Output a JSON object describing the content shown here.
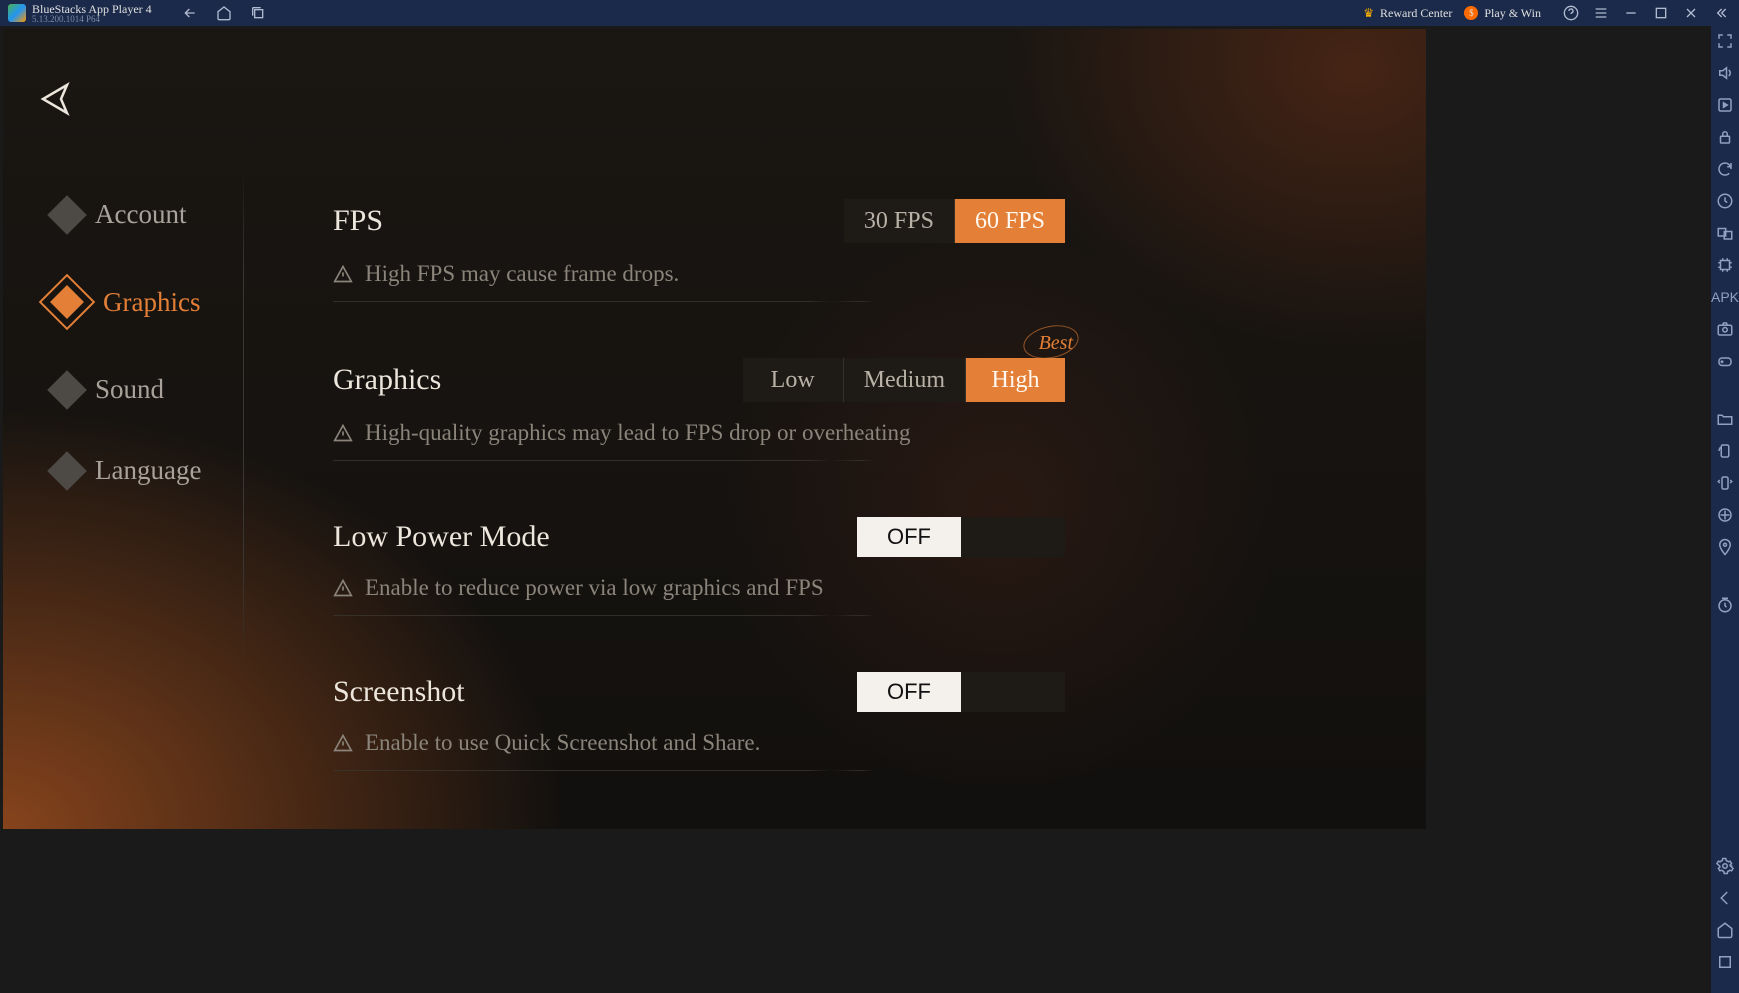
{
  "titlebar": {
    "app_name": "BlueStacks App Player 4",
    "version": "5.13.200.1014  P64",
    "reward_label": "Reward Center",
    "playwin_label": "Play & Win"
  },
  "sidebar": {
    "items": [
      {
        "label": "Account"
      },
      {
        "label": "Graphics"
      },
      {
        "label": "Sound"
      },
      {
        "label": "Language"
      }
    ],
    "active_index": 1
  },
  "settings": {
    "fps": {
      "title": "FPS",
      "hint": "High FPS may cause frame drops.",
      "options": [
        "30 FPS",
        "60 FPS"
      ],
      "active": 1
    },
    "graphics": {
      "title": "Graphics",
      "hint": "High-quality graphics may lead to FPS drop or overheating",
      "options": [
        "Low",
        "Medium",
        "High"
      ],
      "active": 2,
      "best_label": "Best"
    },
    "low_power": {
      "title": "Low Power Mode",
      "hint": "Enable to reduce power via low graphics and FPS",
      "value": "OFF"
    },
    "screenshot": {
      "title": "Screenshot",
      "hint": "Enable to use Quick Screenshot and Share.",
      "value": "OFF"
    }
  }
}
